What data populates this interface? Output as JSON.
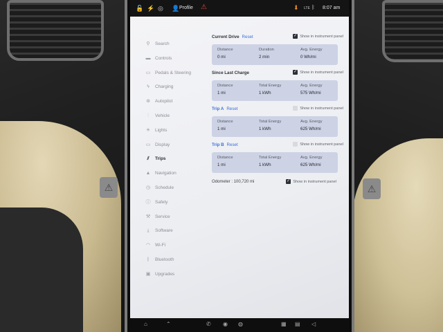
{
  "status_bar": {
    "profile_label": "Profile",
    "lte_label": "LTE",
    "time": "8:07 am"
  },
  "sidebar": {
    "items": [
      {
        "label": "Search",
        "icon": "search-icon"
      },
      {
        "label": "Controls",
        "icon": "car-icon"
      },
      {
        "label": "Pedals & Steering",
        "icon": "steering-icon"
      },
      {
        "label": "Charging",
        "icon": "bolt-icon"
      },
      {
        "label": "Autopilot",
        "icon": "wheel-icon"
      },
      {
        "label": "Vehicle",
        "icon": "sliders-icon"
      },
      {
        "label": "Lights",
        "icon": "sun-icon"
      },
      {
        "label": "Display",
        "icon": "display-icon"
      },
      {
        "label": "Trips",
        "icon": "trips-icon",
        "active": true
      },
      {
        "label": "Navigation",
        "icon": "navigation-icon"
      },
      {
        "label": "Schedule",
        "icon": "clock-icon"
      },
      {
        "label": "Safety",
        "icon": "info-icon"
      },
      {
        "label": "Service",
        "icon": "wrench-icon"
      },
      {
        "label": "Software",
        "icon": "download-icon"
      },
      {
        "label": "Wi-Fi",
        "icon": "wifi-icon"
      },
      {
        "label": "Bluetooth",
        "icon": "bluetooth-icon"
      },
      {
        "label": "Upgrades",
        "icon": "bag-icon"
      }
    ]
  },
  "current_drive": {
    "title": "Current Drive",
    "reset": "Reset",
    "checkbox_label": "Show in instrument panel",
    "checked": true,
    "labels": [
      "Distance",
      "Duration",
      "Avg. Energy"
    ],
    "values": [
      "0 mi",
      "2 min",
      "0 Wh/mi"
    ]
  },
  "since_last_charge": {
    "title": "Since Last Charge",
    "checkbox_label": "Show in instrument panel",
    "checked": true,
    "labels": [
      "Distance",
      "Total Energy",
      "Avg. Energy"
    ],
    "values": [
      "1 mi",
      "1 kWh",
      "575 Wh/mi"
    ]
  },
  "trip_a": {
    "title": "Trip A",
    "reset": "Reset",
    "checkbox_label": "Show in instrument panel",
    "checked": false,
    "labels": [
      "Distance",
      "Total Energy",
      "Avg. Energy"
    ],
    "values": [
      "1 mi",
      "1 kWh",
      "625 Wh/mi"
    ]
  },
  "trip_b": {
    "title": "Trip B",
    "reset": "Reset",
    "checkbox_label": "Show in instrument panel",
    "checked": false,
    "labels": [
      "Distance",
      "Total Energy",
      "Avg. Energy"
    ],
    "values": [
      "1 mi",
      "1 kWh",
      "625 Wh/mi"
    ]
  },
  "odometer": {
    "text": "Odometer : 100,720 mi",
    "checkbox_label": "Show in instrument panel",
    "checked": true
  }
}
